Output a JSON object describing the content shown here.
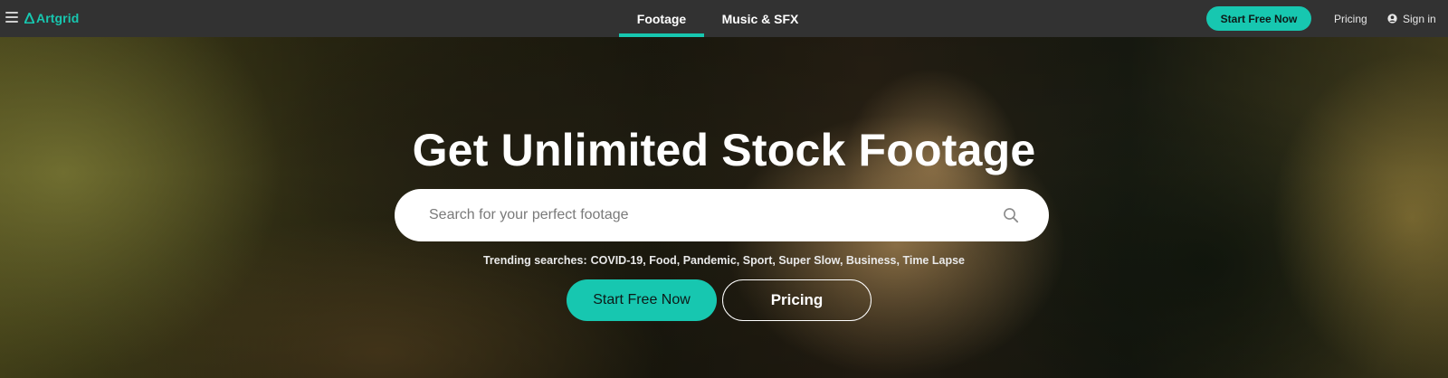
{
  "nav": {
    "logo": "Artgrid",
    "tabs": [
      {
        "label": "Footage",
        "active": true
      },
      {
        "label": "Music & SFX",
        "active": false
      }
    ],
    "cta_label": "Start Free Now",
    "pricing_label": "Pricing",
    "signin_label": "Sign in",
    "icons": [
      "menu-icon",
      "artgrid-logo-icon",
      "user-icon"
    ]
  },
  "hero": {
    "title": "Get Unlimited Stock Footage",
    "search": {
      "placeholder": "Search for your perfect footage",
      "value": ""
    },
    "trending_label": "Trending searches:",
    "trending": [
      "COVID-19",
      "Food",
      "Pandemic",
      "Sport",
      "Super Slow",
      "Business",
      "Time Lapse"
    ],
    "cta_label": "Start Free Now",
    "pricing_label": "Pricing"
  },
  "colors": {
    "accent": "#17c7b0",
    "topbar": "#323232",
    "text_on_dark": "#ffffff"
  }
}
